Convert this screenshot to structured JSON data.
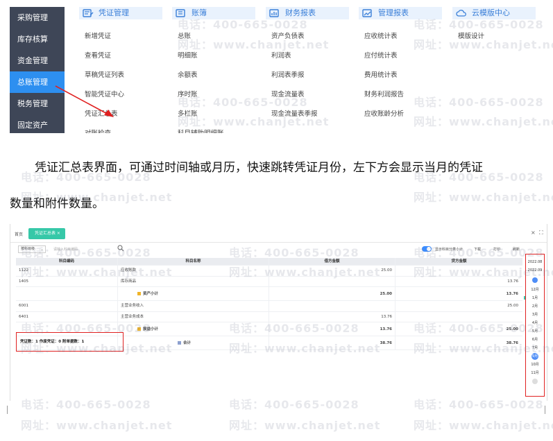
{
  "side_nav": [
    {
      "label": "采购管理"
    },
    {
      "label": "库存核算"
    },
    {
      "label": "资金管理"
    },
    {
      "label": "总账管理",
      "active": true
    },
    {
      "label": "税务管理"
    },
    {
      "label": "固定资产"
    }
  ],
  "menu_columns": [
    {
      "title": "凭证管理",
      "icon": "voucher-icon",
      "items": [
        "新增凭证",
        "查看凭证",
        "草稿凭证列表",
        "智能凭证中心",
        "凭证汇总表",
        "对账检查"
      ]
    },
    {
      "title": "账簿",
      "icon": "ledger-icon",
      "items": [
        "总账",
        "明细账",
        "余额表",
        "序时账",
        "多栏账",
        "科目辅助明细账"
      ]
    },
    {
      "title": "财务报表",
      "icon": "report-icon",
      "items": [
        "资产负债表",
        "利润表",
        "利润表季报",
        "现金流量表",
        "现金流量表季报"
      ]
    },
    {
      "title": "管理报表",
      "icon": "mgmt-report-icon",
      "items": [
        "应收统计表",
        "应付统计表",
        "费用统计表",
        "财务利润报告",
        "应收账龄分析"
      ]
    },
    {
      "title": "云模版中心",
      "icon": "cloud-template-icon",
      "items": [
        "模版设计"
      ]
    }
  ],
  "paragraph": {
    "line1": "凭证汇总表界面，可通过时间轴或月历，快速跳转凭证月份，左下方会显示当月的凭证",
    "line2": "数量和附件数量。"
  },
  "screen2": {
    "tab_home": "首页",
    "tab_active": "凭证汇总表 ×",
    "close_label": "×",
    "fullscreen_label": "⛶",
    "select_value": "按科目级",
    "search_placeholder": "请输入科目编码",
    "toggle_label": "显示科目分类小计",
    "export_label": "下载",
    "print_label": "打印",
    "refresh_label": "刷新",
    "columns": [
      "科目编码",
      "科目名称",
      "借方金额",
      "贷方金额"
    ],
    "rows": [
      {
        "code": "1122",
        "name": "应收账款",
        "debit": "25.00",
        "credit": ""
      },
      {
        "code": "1405",
        "name": "库存商品",
        "debit": "",
        "credit": "13.76"
      },
      {
        "code": "",
        "name": "资产小计",
        "debit": "25.00",
        "credit": "13.76",
        "subtotal": true
      },
      {
        "code": "6001",
        "name": "主营业务收入",
        "debit": "",
        "credit": "25.00"
      },
      {
        "code": "6401",
        "name": "主营业务成本",
        "debit": "13.76",
        "credit": ""
      },
      {
        "code": "",
        "name": "损益小计",
        "debit": "13.76",
        "credit": "25.00",
        "subtotal": true
      }
    ],
    "summary": "凭证数：1    作废凭证：0    附单据数：1",
    "total": {
      "label": "合计",
      "debit": "38.76",
      "credit": "38.76"
    },
    "calendar": {
      "years": [
        "2022.08",
        "2022.09"
      ],
      "months": [
        "12月",
        "1月",
        "2月",
        "3月",
        "4月",
        "5月",
        "6月",
        "7月",
        "9月",
        "10月",
        "11月"
      ],
      "selected_month": "9月"
    }
  },
  "watermark": {
    "phone": "电话：400-665-0028",
    "site": "网址：www.chanjet.net"
  }
}
